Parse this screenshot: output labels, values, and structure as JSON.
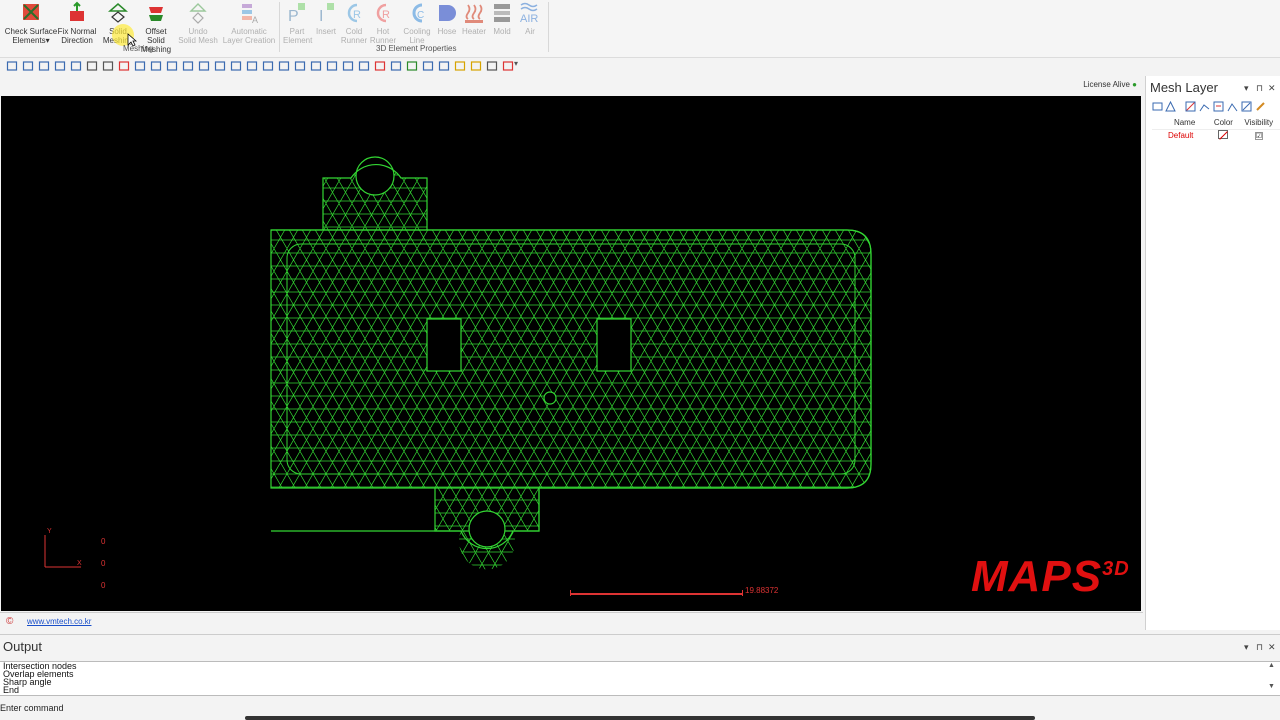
{
  "ribbon": {
    "buttons": [
      {
        "label": "Check Surface Elements",
        "line1": "Check Surface",
        "line2": "Elements▾",
        "icon": "check-surface-icon"
      },
      {
        "label": "Fix Normal Direction",
        "line1": "Fix Normal",
        "line2": "Direction",
        "icon": "fix-normal-icon"
      },
      {
        "label": "Solid Meshing",
        "line1": "Solid",
        "line2": "Meshing",
        "icon": "solid-meshing-icon"
      },
      {
        "label": "Offset Solid Meshing",
        "line1": "Offset Solid",
        "line2": "Meshing",
        "icon": "offset-solid-icon"
      },
      {
        "label": "Undo Solid Mesh",
        "line1": "Undo",
        "line2": "Solid Mesh",
        "icon": "undo-solid-icon"
      },
      {
        "label": "Automatic Layer Creation",
        "line1": "Automatic",
        "line2": "Layer Creation",
        "icon": "auto-layer-icon"
      },
      {
        "label": "Part Element",
        "line1": "Part",
        "line2": "Element",
        "icon": "part-element-icon"
      },
      {
        "label": "Insert",
        "line1": "Insert",
        "line2": "",
        "icon": "insert-icon"
      },
      {
        "label": "Cold Runner",
        "line1": "Cold",
        "line2": "Runner",
        "icon": "cold-runner-icon"
      },
      {
        "label": "Hot Runner",
        "line1": "Hot",
        "line2": "Runner",
        "icon": "hot-runner-icon"
      },
      {
        "label": "Cooling Line",
        "line1": "Cooling",
        "line2": "Line",
        "icon": "cooling-line-icon"
      },
      {
        "label": "Hose",
        "line1": "Hose",
        "line2": "",
        "icon": "hose-icon"
      },
      {
        "label": "Heater",
        "line1": "Heater",
        "line2": "",
        "icon": "heater-icon"
      },
      {
        "label": "Mold",
        "line1": "Mold",
        "line2": "",
        "icon": "mold-icon"
      },
      {
        "label": "Air",
        "line1": "Air",
        "line2": "",
        "icon": "air-icon"
      }
    ],
    "groups": {
      "meshing": "Meshing",
      "properties": "3D Element Properties"
    }
  },
  "status": {
    "license": "License Alive",
    "url": "www.vmtech.co.kr"
  },
  "viewport": {
    "brand_main": "MAPS",
    "brand_sup": "3D",
    "scale_value": "19.88372",
    "axis_y": "Y",
    "axis_x": "X",
    "coord_1": "0",
    "coord_2": "0",
    "coord_3": "0",
    "mesh_color": "#33d633"
  },
  "mesh_panel": {
    "title": "Mesh Layer",
    "columns": [
      "Name",
      "Color",
      "Visibility"
    ],
    "rows": [
      {
        "name": "Default",
        "color": "none",
        "visible": "☑"
      }
    ]
  },
  "output": {
    "title": "Output",
    "lines": [
      "Intersection nodes",
      "Overlap elements",
      "Sharp angle",
      "End"
    ],
    "command_prompt": "Enter command"
  },
  "controls": {
    "pin": "▾ ⊓ ✕"
  }
}
